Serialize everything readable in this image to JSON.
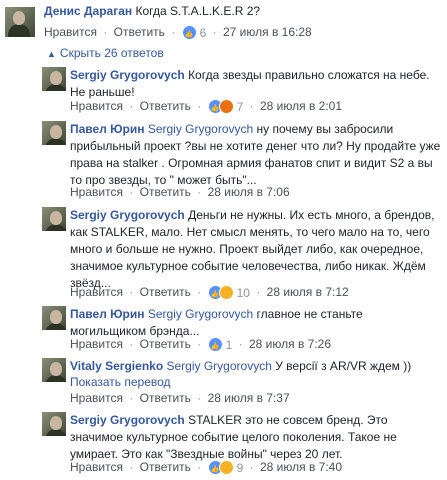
{
  "top_comment": {
    "author": "Денис Дараган",
    "text": "Когда S.T.A.L.K.E.R 2?",
    "like_label": "Нравится",
    "reply_label": "Ответить",
    "reaction_count": "6",
    "timestamp": "27 июля в 16:28"
  },
  "hide_replies": {
    "arrow": "▲",
    "label": "Скрыть 26 ответов"
  },
  "replies": [
    {
      "author": "Sergiy Grygorovych",
      "text": "Когда звезды правильно сложатся на небе. Не раньше!",
      "like_label": "Нравится",
      "reply_label": "Ответить",
      "reaction_count": "7",
      "timestamp": "28 июля в 2:01"
    },
    {
      "author": "Павел Юрин",
      "mention": "Sergiy Grygorovych",
      "text": "ну почему вы забросили прибыльный проект ?вы не хотите денег что ли? Ну продайте уже права на stalker . Огромная армия фанатов спит и видит S2 а вы то про звезды, то \" может быть\"...",
      "like_label": "Нравится",
      "reply_label": "Ответить",
      "timestamp": "28 июля в 7:06"
    },
    {
      "author": "Sergiy Grygorovych",
      "text": "Деньги не нужны. Их есть много, а брендов, как STALKER, мало. Нет смысл менять, то чего мало на то, чего много и больше не нужно. Проект выйдет либо, как очередное, значимое культурное событие человечества, либо никак. Ждём звёзд...",
      "like_label": "Нравится",
      "reply_label": "Ответить",
      "reaction_count": "10",
      "timestamp": "28 июля в 7:12"
    },
    {
      "author": "Павел Юрин",
      "mention": "Sergiy Grygorovych",
      "text": "главное не станьте могильщиком брэнда...",
      "like_label": "Нравится",
      "reply_label": "Ответить",
      "reaction_count": "1",
      "timestamp": "28 июля в 7:26"
    },
    {
      "author": "Vitaly Sergienko",
      "mention": "Sergiy Grygorovych",
      "text": "У версії з AR/VR ждем ))",
      "translate_label": "Показать перевод",
      "like_label": "Нравится",
      "reply_label": "Ответить",
      "timestamp": "28 июля в 7:37"
    },
    {
      "author": "Sergiy Grygorovych",
      "text": "STALKER это не совсем бренд. Это значимое культурное событие целого поколения. Такое не умирает. Это как \"Звездные войны\" через 20 лет.",
      "like_label": "Нравится",
      "reply_label": "Ответить",
      "reaction_count": "9",
      "timestamp": "28 июля в 7:40"
    }
  ],
  "colors": {
    "link": "#365899",
    "meta": "#90949c",
    "text": "#1d2129",
    "like_blue": "#5890ff",
    "haha_yellow": "#f7b125",
    "angry_orange": "#e9710f"
  }
}
